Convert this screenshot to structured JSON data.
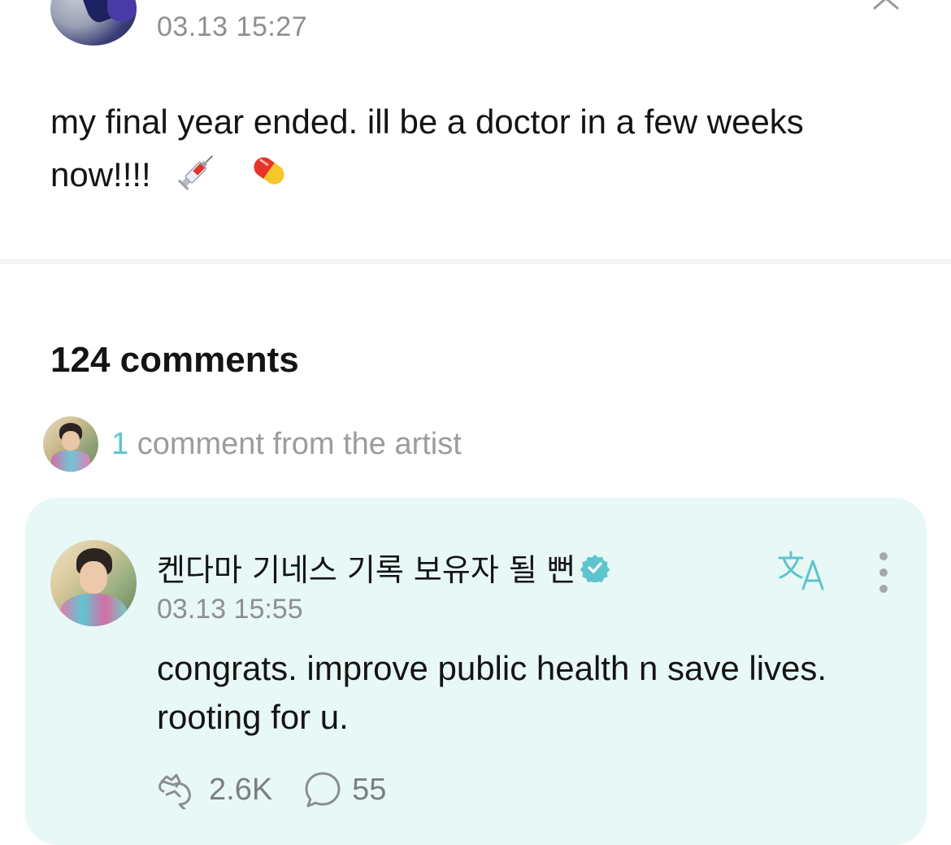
{
  "post": {
    "timestamp": "03.13 15:27",
    "body": "my final year ended. ill be a doctor in a few weeks now!!!!",
    "emojis": [
      "syringe-emoji",
      "pill-emoji"
    ],
    "more_icon": "chevron-up-icon"
  },
  "comments": {
    "count_label": "124 comments",
    "artist_summary": {
      "count": "1",
      "label": " comment from the artist"
    }
  },
  "artist_comment": {
    "author": "켄다마 기네스 기록 보유자 될 뻔",
    "verified_icon": "verified-badge-icon",
    "timestamp": "03.13 15:55",
    "text": "congrats. improve public health n save lives. rooting for u.",
    "translate_icon": "translate-icon",
    "more_icon": "more-vertical-icon",
    "likes": "2.6K",
    "replies": "55"
  },
  "colors": {
    "accent": "#5ec4cd",
    "card_bg": "#e8f8f6",
    "muted_text": "#8d8f94"
  }
}
